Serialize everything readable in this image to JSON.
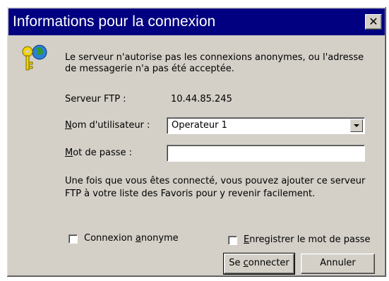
{
  "window": {
    "title": "Informations pour la connexion",
    "close_glyph": "✕"
  },
  "message": "Le serveur n'autorise pas les connexions anonymes, ou l'adresse de messagerie n'a pas été acceptée.",
  "server": {
    "label": "Serveur FTP :",
    "value": "10.44.85.245"
  },
  "username": {
    "label_mnemonic": "N",
    "label_rest": "om d'utilisateur :",
    "value": "Operateur 1"
  },
  "password": {
    "label_mnemonic": "M",
    "label_rest": "ot de passe :",
    "value": ""
  },
  "info": "Une fois que vous êtes connecté, vous pouvez ajouter ce serveur FTP à votre liste des Favoris pour y revenir facilement.",
  "anonymous": {
    "label_before": "Connexion ",
    "label_mnemonic": "a",
    "label_after": "nonyme",
    "checked": false
  },
  "save_password": {
    "label_mnemonic": "E",
    "label_rest": "nregistrer le mot de passe",
    "checked": false
  },
  "buttons": {
    "connect_before": "Se ",
    "connect_mnemonic": "c",
    "connect_after": "onnecter",
    "cancel": "Annuler"
  },
  "colors": {
    "titlebar": "#000080",
    "face": "#d4d0c8"
  },
  "icons": [
    "keys-globe-icon",
    "close-icon",
    "chevron-down-icon"
  ]
}
